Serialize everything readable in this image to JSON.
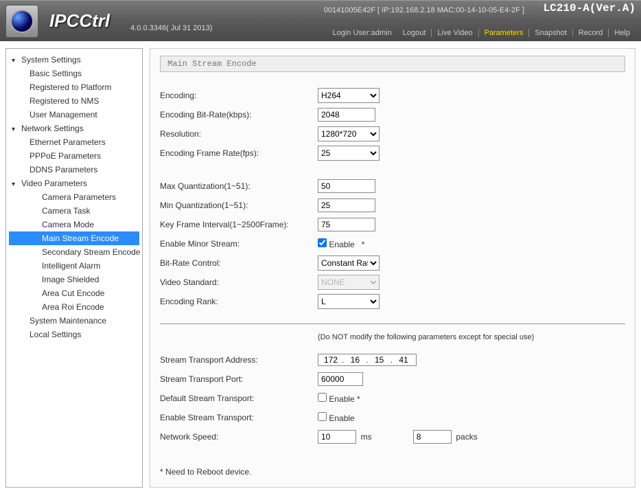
{
  "brand": "IPCCtrl",
  "build": "4.0.0.3346( Jul 31 2013)",
  "deviceId": "00141005E42F [ IP:192.168.2.18  MAC:00-14-10-05-E4-2F ]",
  "deviceName": "LC210-A(Ver.A)",
  "loginText": "Login User:admin",
  "nav": {
    "logout": "Logout",
    "live": "Live Video",
    "params": "Parameters",
    "snapshot": "Snapshot",
    "record": "Record",
    "help": "Help"
  },
  "sidebar": {
    "system": "System Settings",
    "basic": "Basic Settings",
    "regPlatform": "Registered to Platform",
    "regNms": "Registered to NMS",
    "userMgmt": "User Management",
    "network": "Network Settings",
    "ethernet": "Ethernet Parameters",
    "pppoe": "PPPoE Parameters",
    "ddns": "DDNS Parameters",
    "video": "Video Parameters",
    "camParams": "Camera Parameters",
    "camTask": "Camera Task",
    "camMode": "Camera Mode",
    "mainEnc": "Main Stream Encode",
    "secEnc": "Secondary Stream Encode",
    "alarm": "Intelligent Alarm",
    "shield": "Image Shielded",
    "areaCut": "Area Cut Encode",
    "areaRoi": "Area Roi Encode",
    "sysMaint": "System Maintenance",
    "local": "Local Settings"
  },
  "section": "Main Stream Encode",
  "form": {
    "encoding": {
      "label": "Encoding:",
      "value": "H264"
    },
    "bitrate": {
      "label": "Encoding Bit-Rate(kbps):",
      "value": "2048"
    },
    "resolution": {
      "label": "Resolution:",
      "value": "1280*720"
    },
    "framerate": {
      "label": "Encoding Frame Rate(fps):",
      "value": "25"
    },
    "maxQ": {
      "label": "Max Quantization(1~51):",
      "value": "50"
    },
    "minQ": {
      "label": "Min Quantization(1~51):",
      "value": "25"
    },
    "keyframe": {
      "label": "Key Frame Interval(1~2500Frame):",
      "value": "75"
    },
    "minorStream": {
      "label": "Enable Minor Stream:",
      "checkLabel": "Enable",
      "star": "*"
    },
    "rateCtrl": {
      "label": "Bit-Rate Control:",
      "value": "Constant Rate"
    },
    "videoStd": {
      "label": "Video Standard:",
      "value": "NONE"
    },
    "encRank": {
      "label": "Encoding Rank:",
      "value": "L"
    },
    "warn": "(Do NOT modify the following parameters except for special use)",
    "transAddr": {
      "label": "Stream Transport Address:",
      "a": "172",
      "b": "16",
      "c": "15",
      "d": "41"
    },
    "transPort": {
      "label": "Stream Transport Port:",
      "value": "60000"
    },
    "defTrans": {
      "label": "Default Stream Transport:",
      "checkLabel": "Enable *"
    },
    "enTrans": {
      "label": "Enable Stream Transport:",
      "checkLabel": "Enable"
    },
    "netSpeed": {
      "label": "Network Speed:",
      "ms": "10",
      "msUnit": "ms",
      "packs": "8",
      "packsUnit": "packs"
    },
    "reboot": "* Need to Reboot device."
  }
}
